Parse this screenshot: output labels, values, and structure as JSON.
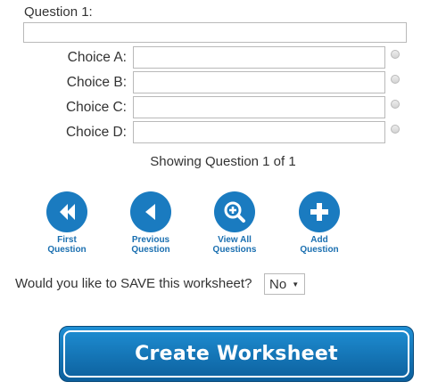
{
  "question": {
    "label": "Question 1:",
    "value": ""
  },
  "choices": [
    {
      "label": "Choice A:",
      "value": ""
    },
    {
      "label": "Choice B:",
      "value": ""
    },
    {
      "label": "Choice C:",
      "value": ""
    },
    {
      "label": "Choice D:",
      "value": ""
    }
  ],
  "pagination": {
    "text": "Showing Question 1 of 1"
  },
  "nav": [
    {
      "label": "First\nQuestion",
      "icon": "first-icon"
    },
    {
      "label": "Previous\nQuestion",
      "icon": "previous-icon"
    },
    {
      "label": "View All\nQuestions",
      "icon": "zoom-in-icon"
    },
    {
      "label": "Add\nQuestion",
      "icon": "plus-icon"
    }
  ],
  "save": {
    "prompt": "Would you like to SAVE this worksheet?",
    "selected": "No"
  },
  "create_button": {
    "label": "Create Worksheet"
  },
  "colors": {
    "accent": "#1a7bc0",
    "nav_text": "#1a6fb0"
  }
}
